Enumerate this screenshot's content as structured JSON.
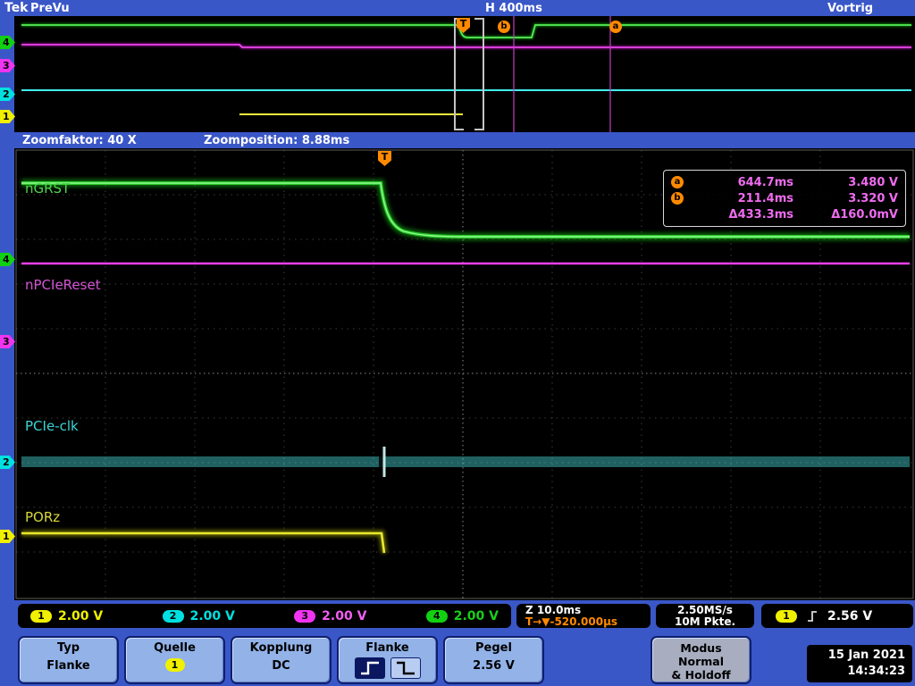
{
  "header": {
    "logo": "Tek",
    "acq_status": "PreVu",
    "horizontal_scale": "H 400ms",
    "trigger_status": "Vortrig"
  },
  "zoom_bar": {
    "factor": "Zoomfaktor: 40 X",
    "position": "Zoomposition: 8.88ms"
  },
  "overview": {
    "trigger_marker": "T",
    "cursor_a": "a",
    "cursor_b": "b",
    "channel_markers": [
      "4",
      "3",
      "2",
      "1"
    ]
  },
  "main_view": {
    "trigger_marker": "T",
    "channel_markers": [
      "4",
      "3",
      "2",
      "1"
    ],
    "trace_labels": {
      "ch4": "nGRST",
      "ch3": "nPCIeReset",
      "ch2": "PCIe-clk",
      "ch1": "PORz"
    }
  },
  "cursor_readout": {
    "a_marker": "a",
    "a_time": "644.7ms",
    "a_volts": "3.480 V",
    "b_marker": "b",
    "b_time": "211.4ms",
    "b_volts": "3.320 V",
    "delta_time": "Δ433.3ms",
    "delta_volts": "Δ160.0mV"
  },
  "status_bar": {
    "channels": [
      {
        "num": "1",
        "scale": "2.00 V"
      },
      {
        "num": "2",
        "scale": "2.00 V"
      },
      {
        "num": "3",
        "scale": "2.00 V"
      },
      {
        "num": "4",
        "scale": "2.00 V"
      }
    ],
    "zoom_scale": "Z 10.0ms",
    "trigger_position": "T→▼-520.000µs",
    "sample_rate": "2.50MS/s",
    "record_length": "10M Pkte.",
    "trigger_channel": "1",
    "trigger_level": "2.56 V"
  },
  "menu": {
    "buttons": [
      {
        "title": "Typ",
        "value": "Flanke"
      },
      {
        "title": "Quelle",
        "value": "1"
      },
      {
        "title": "Kopplung",
        "value": "DC"
      },
      {
        "title": "Flanke",
        "value": ""
      },
      {
        "title": "Pegel",
        "value": "2.56 V"
      }
    ],
    "modus_lines": [
      "Modus",
      "Normal",
      "& Holdoff"
    ],
    "date": "15 Jan 2021",
    "time": "14:34:23"
  },
  "colors": {
    "ch1": "#f0f000",
    "ch2": "#00e0e0",
    "ch3": "#f034f0",
    "ch4": "#12d012",
    "accent_blue": "#3a57c8",
    "trigger_orange": "#ff8a00",
    "cursor_magenta": "#f06cf0"
  }
}
